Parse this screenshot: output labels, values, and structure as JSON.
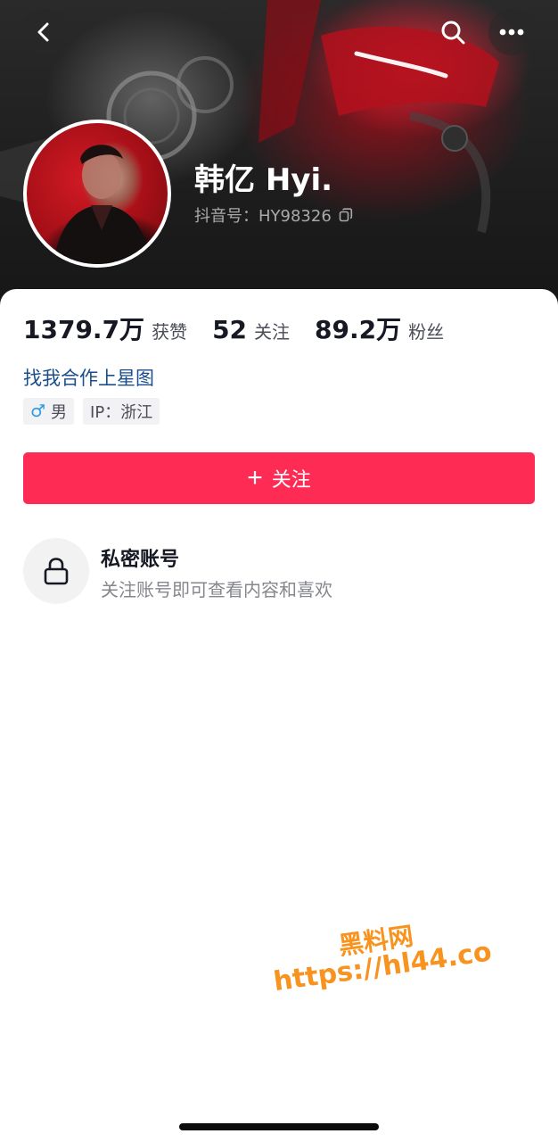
{
  "header": {
    "back_icon": "chevron-left-icon",
    "search_icon": "search-icon",
    "more_icon": "more-dots-icon"
  },
  "profile": {
    "name": "韩亿 Hyi.",
    "id_text": "抖音号：HY98326",
    "copy_icon": "copy-icon"
  },
  "stats": [
    {
      "value": "1379.7万",
      "label": "获赞"
    },
    {
      "value": "52",
      "label": "关注"
    },
    {
      "value": "89.2万",
      "label": "粉丝"
    }
  ],
  "star_link": "找我合作上星图",
  "tags": {
    "gender_symbol": "♂",
    "gender": "男",
    "ip": "IP：浙江"
  },
  "follow_button": {
    "plus": "+",
    "label": "关注"
  },
  "private_account": {
    "title": "私密账号",
    "description": "关注账号即可查看内容和喜欢"
  },
  "watermark": {
    "line1": "黑料网",
    "line2": "https://hl44.co"
  },
  "colors": {
    "accent": "#fe2c55",
    "link": "#1b4e8c",
    "watermark": "#f7931e"
  }
}
